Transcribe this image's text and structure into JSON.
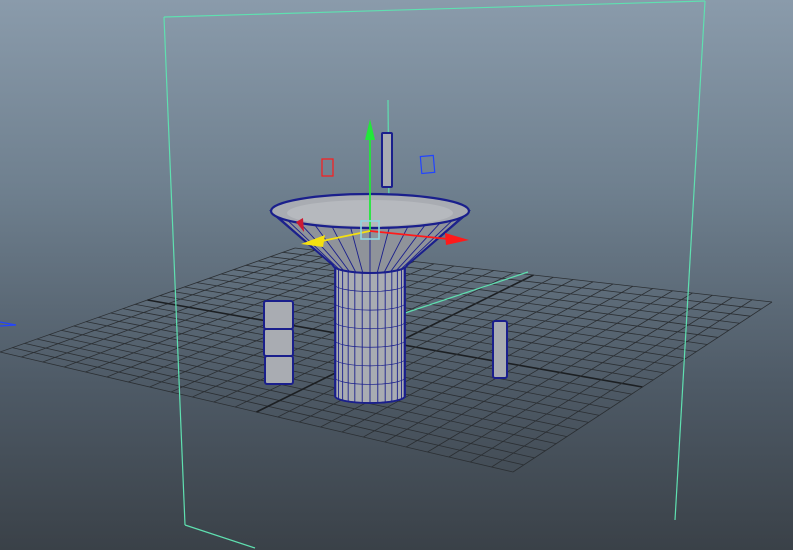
{
  "viewport": {
    "background_top": "#8a9bab",
    "background_bottom": "#3a4148"
  },
  "colors": {
    "grid": "#2b2f33",
    "grid_axis": "#1c1f22",
    "camera_frame": "#5fe0b0",
    "wire": "#1a1f8c",
    "surface": "#a9acb2",
    "surface_dark": "#8f939a",
    "axis_x": "#ff1a1a",
    "axis_y": "#22e83a",
    "axis_z": "#2244ff",
    "handle_yellow": "#f5e010",
    "handle_center": "#8fd6e0"
  },
  "icons": {
    "move_manipulator": "move-manipulator-icon"
  }
}
